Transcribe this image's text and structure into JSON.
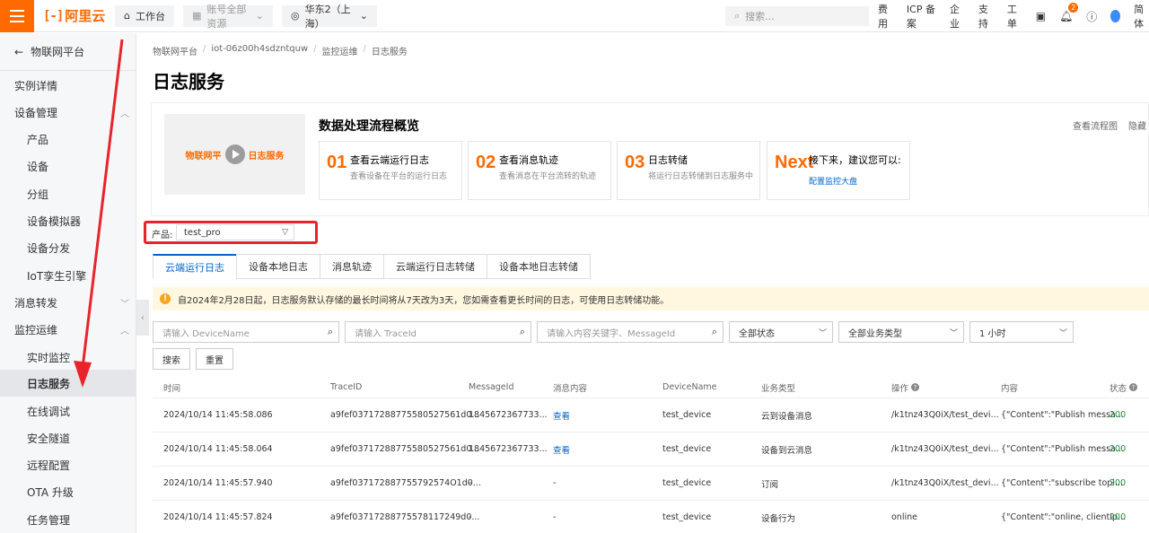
{
  "topbar": {
    "logo_mark": "[-]",
    "logo_text": "阿里云",
    "workbench": "工作台",
    "account": "账号全部资源",
    "region": "华东2（上海）",
    "search_placeholder": "搜索...",
    "links": [
      "费用",
      "ICP 备案",
      "企业",
      "支持",
      "工单"
    ],
    "notify_count": "2",
    "lang": "简体"
  },
  "sidebar": {
    "back_label": "物联网平台",
    "items": [
      {
        "label": "实例详情"
      },
      {
        "label": "设备管理"
      },
      {
        "label": "产品"
      },
      {
        "label": "设备"
      },
      {
        "label": "分组"
      },
      {
        "label": "设备模拟器"
      },
      {
        "label": "设备分发"
      },
      {
        "label": "IoT孪生引擎"
      },
      {
        "label": "消息转发"
      },
      {
        "label": "监控运维"
      },
      {
        "label": "实时监控"
      },
      {
        "label": "日志服务"
      },
      {
        "label": "在线调试"
      },
      {
        "label": "安全隧道"
      },
      {
        "label": "远程配置"
      },
      {
        "label": "OTA 升级"
      },
      {
        "label": "任务管理"
      }
    ]
  },
  "breadcrumb": [
    "物联网平台",
    "iot-06z00h4sdzntquw",
    "监控运维",
    "日志服务"
  ],
  "page_title": "日志服务",
  "overview": {
    "thumb_left": "物联网平",
    "thumb_right": "日志服务",
    "title": "数据处理流程概览",
    "links": [
      "查看流程图",
      "隐藏"
    ],
    "steps": [
      {
        "num": "01",
        "title": "查看云端运行日志",
        "desc": "查看设备在平台的运行日志"
      },
      {
        "num": "02",
        "title": "查看消息轨迹",
        "desc": "查看消息在平台流转的轨迹"
      },
      {
        "num": "03",
        "title": "日志转储",
        "desc": "将运行日志转储到日志服务中"
      },
      {
        "num": "Next",
        "title": "接下来，建议您可以:",
        "link": "配置监控大盘"
      }
    ]
  },
  "product": {
    "label": "产品:",
    "value": "test_pro"
  },
  "tabs": [
    "云端运行日志",
    "设备本地日志",
    "消息轨迹",
    "云端运行日志转储",
    "设备本地日志转储"
  ],
  "notice": "自2024年2月28日起，日志服务默认存储的最长时间将从7天改为3天，您如需查看更长时间的日志，可使用日志转储功能。",
  "filters": {
    "device_placeholder": "请输入 DeviceName",
    "trace_placeholder": "请输入 TraceId",
    "content_placeholder": "请输入内容关键字、MessageId",
    "status": "全部状态",
    "biz_type": "全部业务类型",
    "time_range": "1 小时",
    "search_btn": "搜索",
    "reset_btn": "重置"
  },
  "table": {
    "headers": [
      "时间",
      "TraceID",
      "MessageId",
      "消息内容",
      "DeviceName",
      "业务类型",
      "操作",
      "内容",
      "状态"
    ],
    "rows": [
      [
        "2024/10/14 11:45:58.086",
        "a9fef03717288775580527561d0...",
        "1845672367733...",
        "查看",
        "test_device",
        "云到设备消息",
        "/k1tnz43Q0iX/test_devi...",
        "{\"Content\":\"Publish messa...",
        "200"
      ],
      [
        "2024/10/14 11:45:58.064",
        "a9fef03717288775580527561d0...",
        "1845672367733...",
        "查看",
        "test_device",
        "设备到云消息",
        "/k1tnz43Q0iX/test_devi...",
        "{\"Content\":\"Publish messa...",
        "200"
      ],
      [
        "2024/10/14 11:45:57.940",
        "a9fef037172887755792574O1d0...",
        "-",
        "-",
        "test_device",
        "订阅",
        "/k1tnz43Q0iX/test_devi...",
        "{\"Content\":\"subscribe topi...",
        "200"
      ],
      [
        "2024/10/14 11:45:57.824",
        "a9fef03717288775578117249d0...",
        "-",
        "-",
        "test_device",
        "设备行为",
        "online",
        "{\"Content\":\"online, clientIp...",
        "200"
      ]
    ]
  },
  "colors": {
    "brand": "#ff6a00",
    "link": "#0064c8",
    "highlight": "#e8232a",
    "success": "#1e8e3e"
  }
}
